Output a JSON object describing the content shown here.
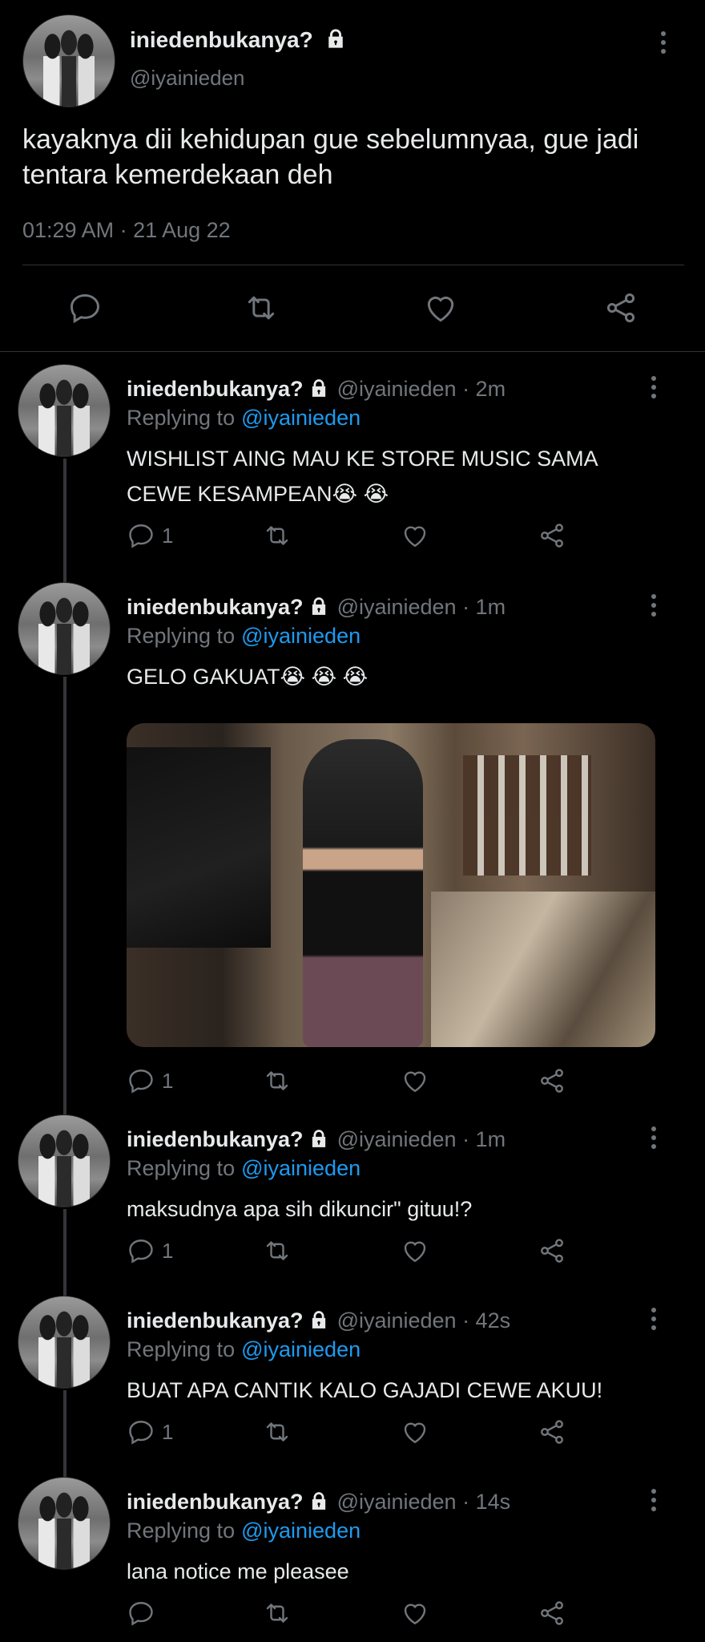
{
  "main_tweet": {
    "display_name": "iniedenbukanya?",
    "handle": "@iyainieden",
    "text": "kayaknya dii kehidupan gue sebelumnyaa, gue jadi tentara kemerdekaan deh",
    "timestamp": "01:29 AM · 21 Aug 22",
    "icons": [
      "reply-icon",
      "retweet-icon",
      "like-icon",
      "share-icon"
    ]
  },
  "replies": [
    {
      "display_name": "iniedenbukanya?",
      "meta": "@iyainieden · 2m",
      "replying_label": "Replying to",
      "mention": "@iyainieden",
      "text_line1": "WISHLIST AING MAU KE STORE MUSIC SAMA",
      "text_line2": "CEWE KESAMPEAN😭 😭",
      "reply_count": "1"
    },
    {
      "display_name": "iniedenbukanya?",
      "meta": "@iyainieden · 1m",
      "replying_label": "Replying to",
      "mention": "@iyainieden",
      "text_line1": "GELO GAKUAT😭 😭 😭",
      "reply_count": "1",
      "has_media": true
    },
    {
      "display_name": "iniedenbukanya?",
      "meta": "@iyainieden · 1m",
      "replying_label": "Replying to",
      "mention": "@iyainieden",
      "text_line1": "maksudnya apa sih dikuncir\" gituu!?",
      "reply_count": "1"
    },
    {
      "display_name": "iniedenbukanya?",
      "meta": "@iyainieden · 42s",
      "replying_label": "Replying to",
      "mention": "@iyainieden",
      "text_line1": "BUAT APA CANTIK KALO GAJADI CEWE AKUU!",
      "reply_count": "1"
    },
    {
      "display_name": "iniedenbukanya?",
      "meta": "@iyainieden · 14s",
      "replying_label": "Replying to",
      "mention": "@iyainieden",
      "text_line1": "lana notice me pleasee",
      "reply_count": ""
    }
  ],
  "colors": {
    "background": "#000000",
    "text": "#e7e9ea",
    "muted": "#71767b",
    "link": "#1d9bf0",
    "divider": "#2f3336"
  }
}
